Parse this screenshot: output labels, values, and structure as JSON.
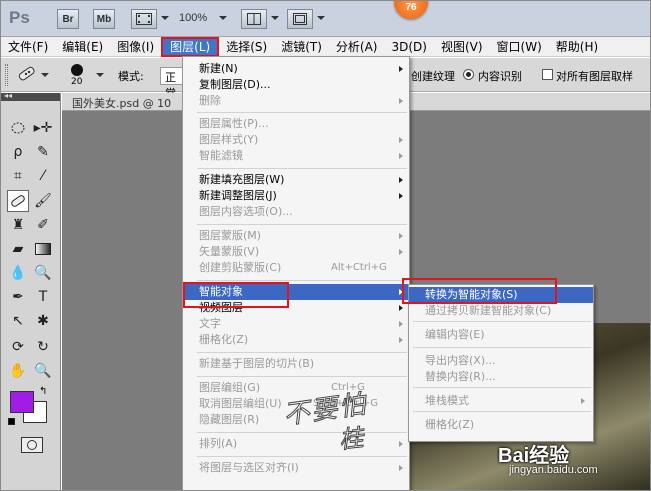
{
  "app": {
    "logo": "Ps",
    "br_label": "Br",
    "mb_label": "Mb",
    "zoom": "100%",
    "badge": "76"
  },
  "menubar": {
    "items": [
      "文件(F)",
      "编辑(E)",
      "图像(I)",
      "图层(L)",
      "选择(S)",
      "滤镜(T)",
      "分析(A)",
      "3D(D)",
      "视图(V)",
      "窗口(W)",
      "帮助(H)"
    ],
    "active_index": 3
  },
  "options": {
    "brush_size": "20",
    "mode_label": "模式:",
    "mode_value": "正常",
    "texture_label": "创建纹理",
    "content_aware_label": "内容识别",
    "sample_all_label": "对所有图层取样"
  },
  "document": {
    "tab_title": "国外美女.psd @ 10"
  },
  "layer_menu": {
    "items": [
      {
        "label": "新建(N)",
        "shortcut": "",
        "submenu": true,
        "disabled": false
      },
      {
        "label": "复制图层(D)...",
        "shortcut": "",
        "submenu": false,
        "disabled": false
      },
      {
        "label": "删除",
        "shortcut": "",
        "submenu": true,
        "disabled": true
      },
      {
        "label": "图层属性(P)...",
        "shortcut": "",
        "submenu": false,
        "disabled": true
      },
      {
        "label": "图层样式(Y)",
        "shortcut": "",
        "submenu": true,
        "disabled": true
      },
      {
        "label": "智能滤镜",
        "shortcut": "",
        "submenu": true,
        "disabled": true
      },
      {
        "label": "新建填充图层(W)",
        "shortcut": "",
        "submenu": true,
        "disabled": false
      },
      {
        "label": "新建调整图层(J)",
        "shortcut": "",
        "submenu": true,
        "disabled": false
      },
      {
        "label": "图层内容选项(O)...",
        "shortcut": "",
        "submenu": false,
        "disabled": true
      },
      {
        "label": "图层蒙版(M)",
        "shortcut": "",
        "submenu": true,
        "disabled": true
      },
      {
        "label": "矢量蒙版(V)",
        "shortcut": "",
        "submenu": true,
        "disabled": true
      },
      {
        "label": "创建剪贴蒙版(C)",
        "shortcut": "Alt+Ctrl+G",
        "submenu": false,
        "disabled": true
      },
      {
        "label": "智能对象",
        "shortcut": "",
        "submenu": true,
        "disabled": false,
        "highlighted": true
      },
      {
        "label": "视频图层",
        "shortcut": "",
        "submenu": true,
        "disabled": false
      },
      {
        "label": "文字",
        "shortcut": "",
        "submenu": true,
        "disabled": true
      },
      {
        "label": "栅格化(Z)",
        "shortcut": "",
        "submenu": true,
        "disabled": true
      },
      {
        "label": "新建基于图层的切片(B)",
        "shortcut": "",
        "submenu": false,
        "disabled": true
      },
      {
        "label": "图层编组(G)",
        "shortcut": "Ctrl+G",
        "submenu": false,
        "disabled": true
      },
      {
        "label": "取消图层编组(U)",
        "shortcut": "Shift+Ctrl+G",
        "submenu": false,
        "disabled": true
      },
      {
        "label": "隐藏图层(R)",
        "shortcut": "",
        "submenu": false,
        "disabled": true
      },
      {
        "label": "排列(A)",
        "shortcut": "",
        "submenu": true,
        "disabled": true
      },
      {
        "label": "将图层与选区对齐(I)",
        "shortcut": "",
        "submenu": true,
        "disabled": true
      }
    ]
  },
  "smart_object_menu": {
    "items": [
      {
        "label": "转换为智能对象(S)",
        "disabled": false,
        "highlighted": true,
        "submenu": false
      },
      {
        "label": "通过拷贝新建智能对象(C)",
        "disabled": true,
        "submenu": false
      },
      {
        "label": "编辑内容(E)",
        "disabled": true,
        "submenu": false
      },
      {
        "label": "导出内容(X)...",
        "disabled": true,
        "submenu": false
      },
      {
        "label": "替换内容(R)...",
        "disabled": true,
        "submenu": false
      },
      {
        "label": "堆栈模式",
        "disabled": true,
        "submenu": true
      },
      {
        "label": "栅格化(Z)",
        "disabled": true,
        "submenu": false
      }
    ]
  },
  "watermark": {
    "handwriting_1": "不要怕",
    "handwriting_2": "桂",
    "brand": "Bai经验",
    "url": "jingyan.baidu.com"
  },
  "colors": {
    "foreground": "#a21ce8",
    "background": "#ffffff",
    "highlight": "#3c68c4",
    "annotation_red": "#e4141c"
  }
}
